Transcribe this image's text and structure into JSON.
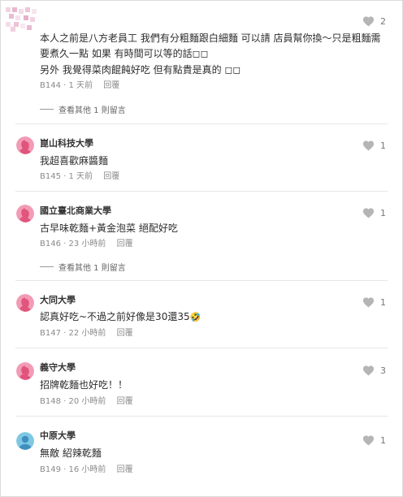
{
  "comments": [
    {
      "author": "",
      "avatar": "pixelated-avatar",
      "lines": [
        "本人之前是八方老員工  我們有分粗麵跟白細麵 可以請 店員幫你換～只是粗麵需",
        "要煮久一點 如果 有時間可以等的話◻◻",
        "另外 我覺得菜肉餛飩好吃  但有點貴是真的 ◻◻"
      ],
      "floor": "B144",
      "time": "1 天前",
      "reply": "回覆",
      "likes": "2",
      "thread": "查看其他 1 則留言"
    },
    {
      "author": "崑山科技大學",
      "avatar": "female-avatar-icon",
      "avatar_color": "#f29bb5",
      "lines": [
        "我超喜歡麻醬麵"
      ],
      "floor": "B145",
      "time": "1 天前",
      "reply": "回覆",
      "likes": "1",
      "thread": ""
    },
    {
      "author": "國立臺北商業大學",
      "avatar": "female-avatar-icon",
      "avatar_color": "#f29bb5",
      "lines": [
        "古早味乾麵+黃金泡菜 絕配好吃"
      ],
      "floor": "B146",
      "time": "23 小時前",
      "reply": "回覆",
      "likes": "1",
      "thread": "查看其他 1 則留言"
    },
    {
      "author": "大同大學",
      "avatar": "female-avatar-icon",
      "avatar_color": "#f29bb5",
      "lines": [
        "認真好吃~不過之前好像是30還35"
      ],
      "emoji": "🤣",
      "floor": "B147",
      "time": "22 小時前",
      "reply": "回覆",
      "likes": "1",
      "thread": ""
    },
    {
      "author": "義守大學",
      "avatar": "female-avatar-icon",
      "avatar_color": "#f29bb5",
      "lines": [
        "招牌乾麵也好吃！！"
      ],
      "floor": "B148",
      "time": "20 小時前",
      "reply": "回覆",
      "likes": "3",
      "thread": ""
    },
    {
      "author": "中原大學",
      "avatar": "male-avatar-icon",
      "avatar_color": "#7ec8e3",
      "lines": [
        "無敵 紹辣乾麵"
      ],
      "floor": "B149",
      "time": "16 小時前",
      "reply": "回覆",
      "likes": "1",
      "thread": ""
    }
  ]
}
